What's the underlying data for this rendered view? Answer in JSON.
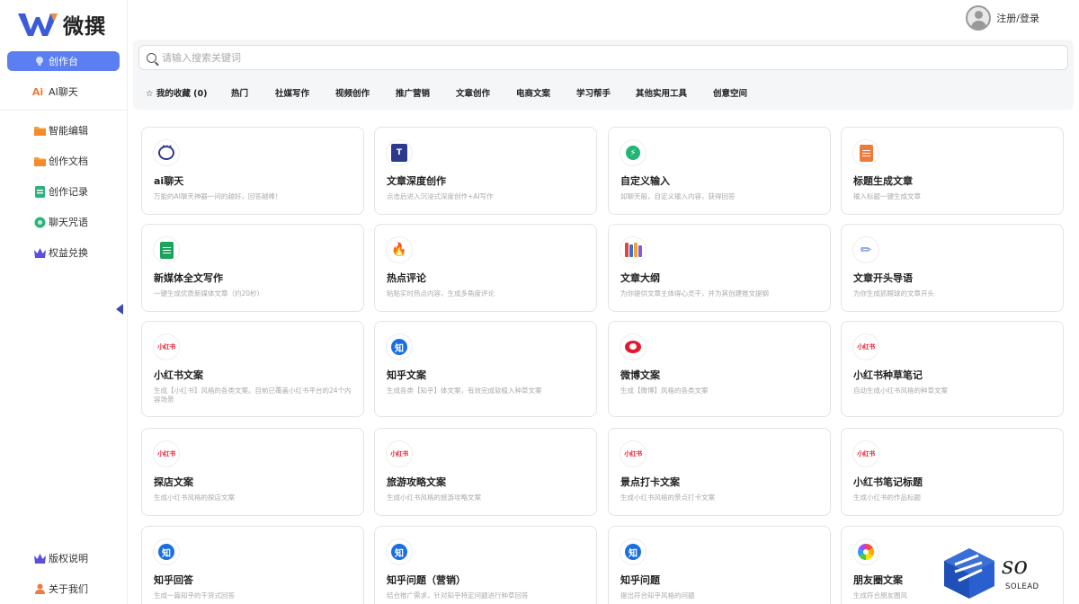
{
  "app": {
    "brand_name": "微撰"
  },
  "header": {
    "login_label": "注册/登录"
  },
  "sidebar": {
    "items": [
      {
        "label": "创作台",
        "icon": "bulb-icon",
        "active": true
      },
      {
        "label": "AI聊天",
        "icon": "ai-icon"
      },
      {
        "label": "智能编辑",
        "icon": "folder-icon"
      },
      {
        "label": "创作文档",
        "icon": "folder-icon"
      },
      {
        "label": "创作记录",
        "icon": "record-icon"
      },
      {
        "label": "聊天咒语",
        "icon": "gear-icon"
      },
      {
        "label": "权益兑换",
        "icon": "crown-icon"
      }
    ],
    "bottom": [
      {
        "label": "版权说明",
        "icon": "crown-icon"
      },
      {
        "label": "关于我们",
        "icon": "user-icon"
      }
    ]
  },
  "search": {
    "placeholder": "请输入搜索关键词"
  },
  "tabs": [
    {
      "label": "☆ 我的收藏 (0)"
    },
    {
      "label": "热门"
    },
    {
      "label": "社媒写作"
    },
    {
      "label": "视频创作"
    },
    {
      "label": "推广营销"
    },
    {
      "label": "文章创作"
    },
    {
      "label": "电商文案"
    },
    {
      "label": "学习帮手"
    },
    {
      "label": "其他实用工具"
    },
    {
      "label": "创意空间"
    }
  ],
  "cards": [
    {
      "title": "ai聊天",
      "desc": "万能的AI聊天神器一问的越好，回答越棒！",
      "icon": "chat-icon"
    },
    {
      "title": "文章深度创作",
      "desc": "点击后进入沉浸式深度创作+AI写作",
      "icon": "t-doc-icon"
    },
    {
      "title": "自定义输入",
      "desc": "如聊天般，自定义输入内容，获得回答",
      "icon": "bolt-icon"
    },
    {
      "title": "标题生成文章",
      "desc": "输入标题一键生成文章",
      "icon": "doc-orange-icon"
    },
    {
      "title": "新媒体全文写作",
      "desc": "一键生成优质新媒体文章（约20秒）",
      "icon": "doc-green-icon"
    },
    {
      "title": "热点评论",
      "desc": "粘贴实时热点内容，生成多角度评论",
      "icon": "fire-icon"
    },
    {
      "title": "文章大纲",
      "desc": "为你提供文章主体得心灵干，并为其创建推文提纲",
      "icon": "books-icon"
    },
    {
      "title": "文章开头导语",
      "desc": "为你生成抓眼球的文章开头",
      "icon": "pencil-icon"
    },
    {
      "title": "小红书文案",
      "desc": "生成【小红书】风格的各类文案。目前已覆盖小红书平台的24个内容场景",
      "icon": "xiaohongshu-icon",
      "badge": "小红书"
    },
    {
      "title": "知乎文案",
      "desc": "生成各类【知乎】体文案，有效完成软植入种草文案",
      "icon": "zhihu-icon",
      "badge": "知"
    },
    {
      "title": "微博文案",
      "desc": "生成【微博】风格的各类文案",
      "icon": "weibo-icon"
    },
    {
      "title": "小红书种草笔记",
      "desc": "自动生成小红书风格的种草文案",
      "icon": "xiaohongshu-icon",
      "badge": "小红书"
    },
    {
      "title": "探店文案",
      "desc": "生成小红书风格的探店文案",
      "icon": "xiaohongshu-icon",
      "badge": "小红书"
    },
    {
      "title": "旅游攻略文案",
      "desc": "生成小红书风格的旅游攻略文案",
      "icon": "xiaohongshu-icon",
      "badge": "小红书"
    },
    {
      "title": "景点打卡文案",
      "desc": "生成小红书风格的景点打卡文案",
      "icon": "xiaohongshu-icon",
      "badge": "小红书"
    },
    {
      "title": "小红书笔记标题",
      "desc": "生成小红书的作品标题",
      "icon": "xiaohongshu-icon",
      "badge": "小红书"
    },
    {
      "title": "知乎回答",
      "desc": "生成一篇知乎的干货式回答",
      "icon": "zhihu-icon",
      "badge": "知"
    },
    {
      "title": "知乎问题（营销）",
      "desc": "结合推广需求，针对知乎特定问题进行种草回答",
      "icon": "zhihu-icon",
      "badge": "知"
    },
    {
      "title": "知乎问题",
      "desc": "提出符合知乎风格的问题",
      "icon": "zhihu-icon",
      "badge": "知"
    },
    {
      "title": "朋友圈文案",
      "desc": "生成符合朋友圈风",
      "icon": "moments-icon"
    }
  ],
  "watermark": {
    "text": "SOLEAD",
    "script": "so"
  },
  "colors": {
    "accent": "#5b7ff2",
    "brand_blue": "#2d3a8c"
  }
}
